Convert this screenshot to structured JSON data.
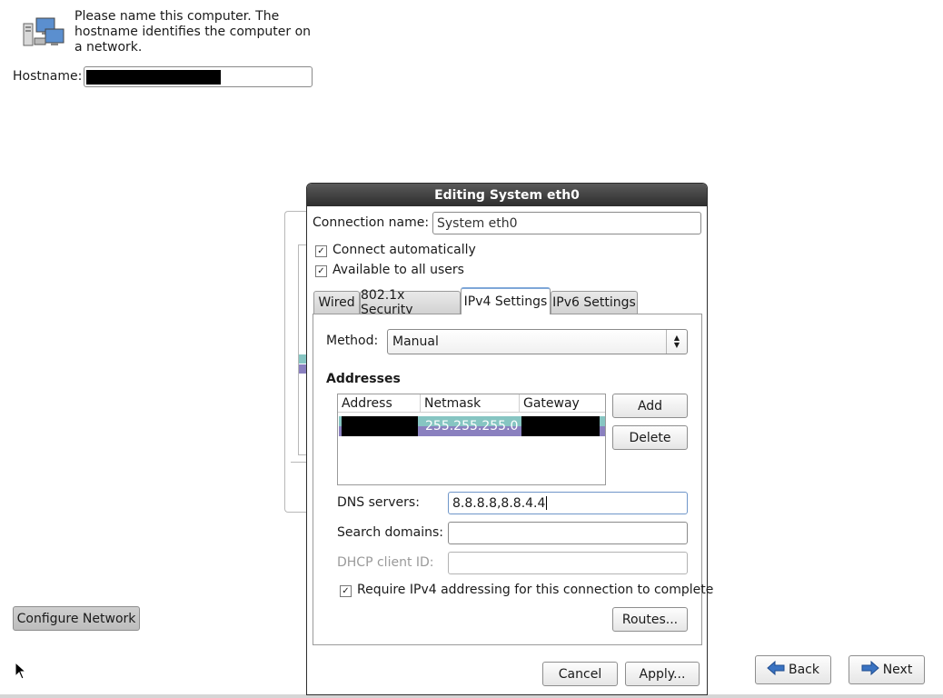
{
  "installer": {
    "prompt": "Please name this computer.  The hostname identifies the computer on a network.",
    "hostname_label": "Hostname:",
    "configure_network_label": "Configure Network",
    "back_label": "Back",
    "next_label": "Next"
  },
  "dialog": {
    "title": "Editing System eth0",
    "connection_name_label": "Connection name:",
    "connection_name_value": "System eth0",
    "connect_automatically_label": "Connect automatically",
    "connect_automatically_checked": true,
    "available_all_users_label": "Available to all users",
    "available_all_users_checked": true,
    "tabs": [
      {
        "label": "Wired",
        "active": false
      },
      {
        "label": "802.1x Security",
        "active": false
      },
      {
        "label": "IPv4 Settings",
        "active": true
      },
      {
        "label": "IPv6 Settings",
        "active": false
      }
    ],
    "method_label": "Method:",
    "method_value": "Manual",
    "addresses_heading": "Addresses",
    "columns": [
      "Address",
      "Netmask",
      "Gateway"
    ],
    "rows": [
      {
        "address": "",
        "netmask": "255.255.255.0",
        "gateway": ""
      }
    ],
    "add_label": "Add",
    "delete_label": "Delete",
    "dns_label": "DNS servers:",
    "dns_value": "8.8.8.8,8.8.4.4",
    "search_domains_label": "Search domains:",
    "search_domains_value": "",
    "dhcp_client_id_label": "DHCP client ID:",
    "dhcp_client_id_value": "",
    "require_ipv4_label": "Require IPv4 addressing for this connection to complete",
    "require_ipv4_checked": true,
    "routes_label": "Routes...",
    "cancel_label": "Cancel",
    "apply_label": "Apply..."
  },
  "colors": {
    "selected_row_top": "#86c5c2",
    "selected_row_bottom": "#8a80bf",
    "titlebar": "#2d2d2d",
    "arrow_blue": "#3a73c2"
  }
}
